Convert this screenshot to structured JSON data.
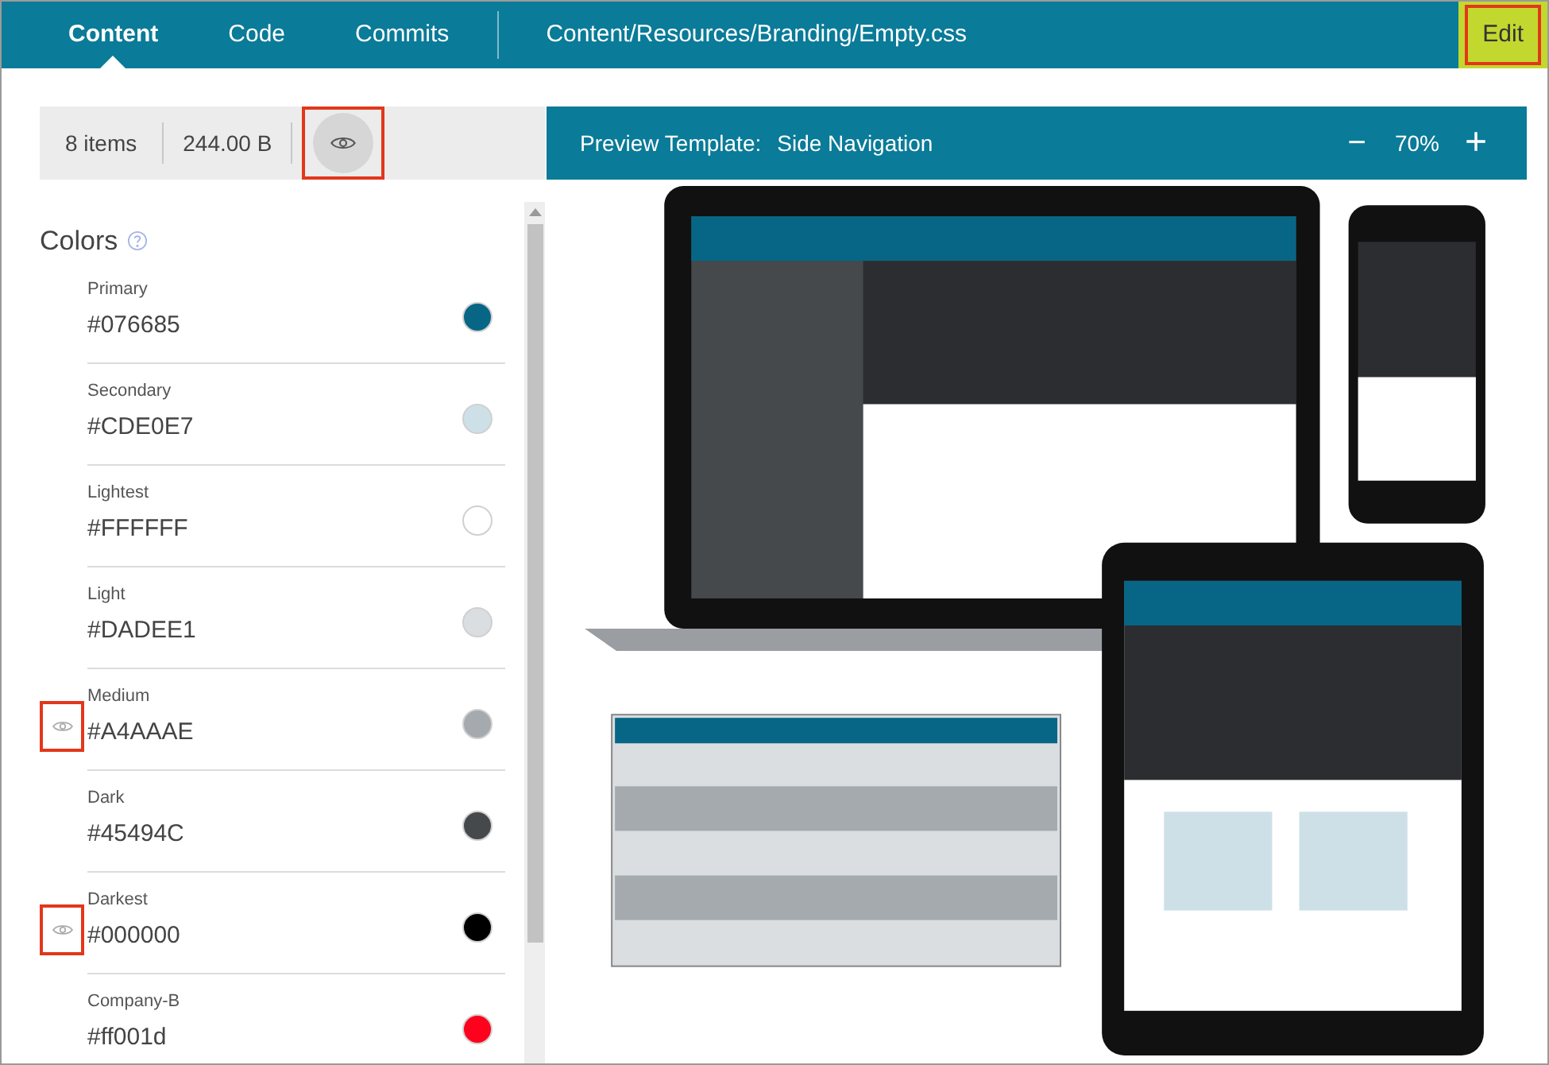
{
  "tabs": [
    {
      "label": "Content",
      "selected": true
    },
    {
      "label": "Code",
      "selected": false
    },
    {
      "label": "Commits",
      "selected": false
    }
  ],
  "file_path": "Content/Resources/Branding/Empty.css",
  "edit_button": {
    "label": "Edit",
    "highlighted": true
  },
  "toolbar": {
    "item_count": "8 items",
    "size": "244.00 B",
    "preview_toggle_highlighted": true
  },
  "colors": {
    "title": "Colors",
    "items": [
      {
        "name": "Primary",
        "value": "#076685",
        "color": "#076685",
        "flagged": false
      },
      {
        "name": "Secondary",
        "value": "#CDE0E7",
        "color": "#cde0e7",
        "flagged": false
      },
      {
        "name": "Lightest",
        "value": "#FFFFFF",
        "color": "#ffffff",
        "flagged": false
      },
      {
        "name": "Light",
        "value": "#DADEE1",
        "color": "#dadee1",
        "flagged": false
      },
      {
        "name": "Medium",
        "value": "#A4AAAE",
        "color": "#a4aaae",
        "flagged": true
      },
      {
        "name": "Dark",
        "value": "#45494C",
        "color": "#45494c",
        "flagged": false
      },
      {
        "name": "Darkest",
        "value": "#000000",
        "color": "#000000",
        "flagged": true
      },
      {
        "name": "Company-B",
        "value": "#ff001d",
        "color": "#ff001d",
        "flagged": false
      }
    ]
  },
  "preview": {
    "label": "Preview Template:",
    "template": "Side Navigation",
    "zoom": "70%",
    "zoom_out": "−",
    "zoom_in": "+"
  }
}
